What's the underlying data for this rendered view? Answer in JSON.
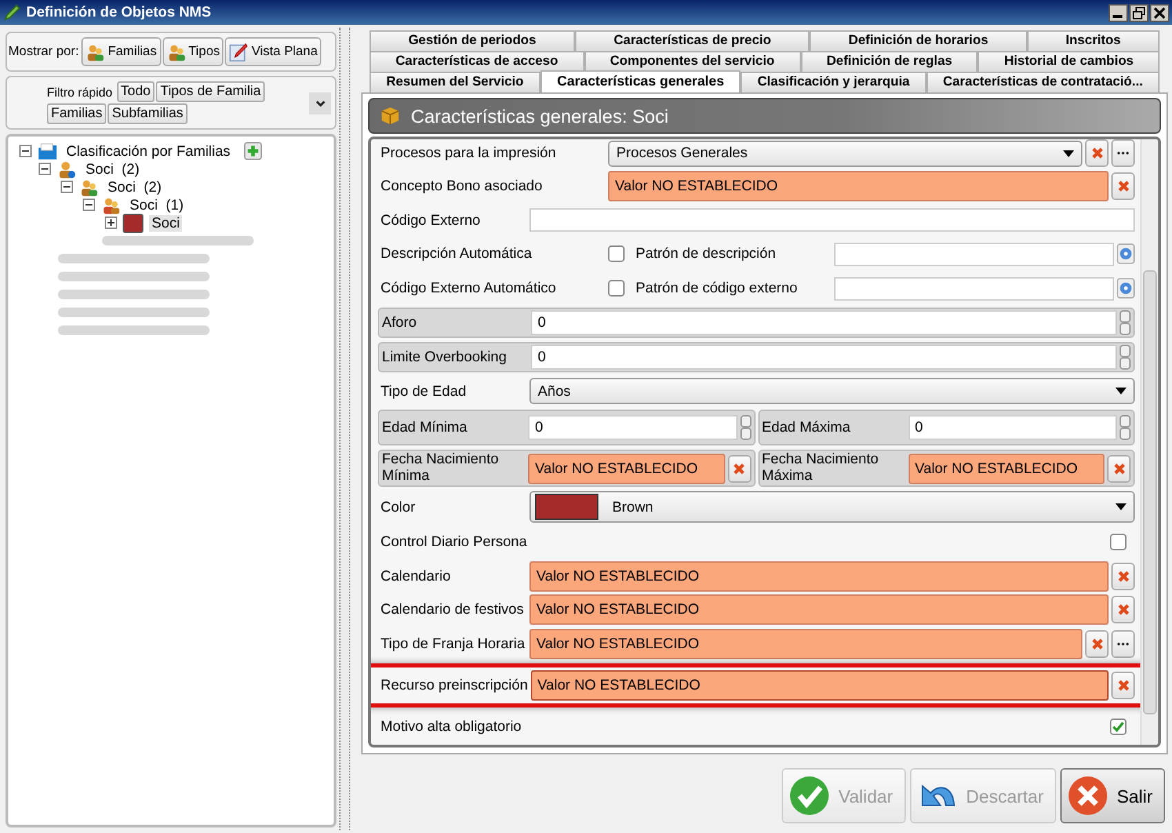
{
  "window": {
    "title": "Definición de Objetos NMS"
  },
  "left_panel": {
    "show_by": {
      "label": "Mostrar por:",
      "buttons": [
        {
          "label": "Familias",
          "kind": "people"
        },
        {
          "label": "Tipos",
          "kind": "people"
        },
        {
          "label": "Vista Plana",
          "kind": "pencil"
        }
      ]
    },
    "quick_filter": {
      "label": "Filtro rápido",
      "buttons": [
        "Todo",
        "Tipos de Familia",
        "Familias",
        "Subfamilias"
      ]
    },
    "tree": {
      "label": "Clasificación por Familias",
      "expanded": true,
      "children": [
        {
          "kind": "node",
          "label": "Soci",
          "count": "(2)",
          "expanded": true,
          "children": [
            {
              "kind": "node",
              "label": "Soci",
              "count": "(2)",
              "expanded": true,
              "children": [
                {
                  "kind": "node",
                  "label": "Soci",
                  "count": "(1)",
                  "expanded": true,
                  "children": [
                    {
                      "kind": "leaf",
                      "label": "Soci",
                      "color": "#a52a2a",
                      "selected": true,
                      "expanded": false
                    }
                  ]
                },
                {
                  "kind": "blurred"
                }
              ]
            }
          ]
        },
        {
          "kind": "blurred"
        },
        {
          "kind": "blurred"
        },
        {
          "kind": "blurred"
        },
        {
          "kind": "blurred"
        },
        {
          "kind": "blurred"
        }
      ]
    }
  },
  "tabs": [
    [
      {
        "label": "Gestión de periodos",
        "selected": false
      },
      {
        "label": "Características de precio",
        "selected": false
      },
      {
        "label": "Definición de horarios",
        "selected": false
      },
      {
        "label": "Inscritos",
        "selected": false
      }
    ],
    [
      {
        "label": "Características de acceso",
        "selected": false
      },
      {
        "label": "Componentes del servicio",
        "selected": false
      },
      {
        "label": "Definición de reglas",
        "selected": false
      },
      {
        "label": "Historial de cambios",
        "selected": false
      }
    ],
    [
      {
        "label": "Resumen del Servicio",
        "selected": false
      },
      {
        "label": "Características generales",
        "selected": true
      },
      {
        "label": "Clasificación y jerarquia",
        "selected": false
      },
      {
        "label": "Características de contratació...",
        "selected": false
      }
    ]
  ],
  "header": {
    "title": "Características generales: Soci"
  },
  "form": [
    {
      "kind": "combo",
      "label": "Procesos para la impresión",
      "value": "Procesos Generales",
      "clear": true,
      "more": true
    },
    {
      "kind": "unset",
      "label": "Concepto Bono asociado",
      "value": "Valor NO ESTABLECIDO",
      "more": false,
      "highlighted": false
    },
    {
      "kind": "text",
      "label": "Código Externo"
    },
    {
      "kind": "auto",
      "label": "Descripción Automática",
      "checked": false,
      "pattern_label": "Patrón de descripción"
    },
    {
      "kind": "auto",
      "label": "Código Externo Automático",
      "checked": false,
      "pattern_label": "Patrón de código externo"
    },
    {
      "kind": "spin",
      "label": "Aforo",
      "value": "0"
    },
    {
      "kind": "spin",
      "label": "Limite Overbooking",
      "value": "0"
    },
    {
      "kind": "combo",
      "label": "Tipo de Edad",
      "value": "Años",
      "clear": false,
      "more": false
    },
    {
      "kind": "pair",
      "items": [
        {
          "kind": "spin",
          "label": "Edad Mínima",
          "value": "0"
        },
        {
          "kind": "spin",
          "label": "Edad Máxima",
          "value": "0"
        }
      ]
    },
    {
      "kind": "pair",
      "items": [
        {
          "kind": "unset",
          "label": "Fecha Nacimiento Mínima",
          "value": "Valor NO ESTABLECIDO"
        },
        {
          "kind": "unset",
          "label": "Fecha Nacimiento Máxima",
          "value": "Valor NO ESTABLECIDO"
        }
      ]
    },
    {
      "kind": "color",
      "label": "Color",
      "value": "Brown",
      "color": "#a52a2a"
    },
    {
      "kind": "check",
      "label": "Control Diario Persona",
      "checked": false
    },
    {
      "kind": "unset",
      "label": "Calendario",
      "value": "Valor NO ESTABLECIDO",
      "more": false,
      "highlighted": false
    },
    {
      "kind": "unset",
      "label": "Calendario de festivos",
      "value": "Valor NO ESTABLECIDO",
      "more": false,
      "highlighted": false
    },
    {
      "kind": "unset",
      "label": "Tipo de Franja Horaria",
      "value": "Valor NO ESTABLECIDO",
      "more": true,
      "highlighted": false
    },
    {
      "kind": "unset",
      "label": "Recurso preinscripción",
      "value": "Valor NO ESTABLECIDO",
      "more": false,
      "highlighted": true
    },
    {
      "kind": "check",
      "label": "Motivo alta obligatorio",
      "checked": true
    }
  ],
  "buttons": [
    {
      "label": "Validar",
      "kind": "check",
      "disabled": true
    },
    {
      "label": "Descartar",
      "kind": "undo",
      "disabled": true
    },
    {
      "label": "Salir",
      "kind": "exit",
      "disabled": false
    }
  ]
}
